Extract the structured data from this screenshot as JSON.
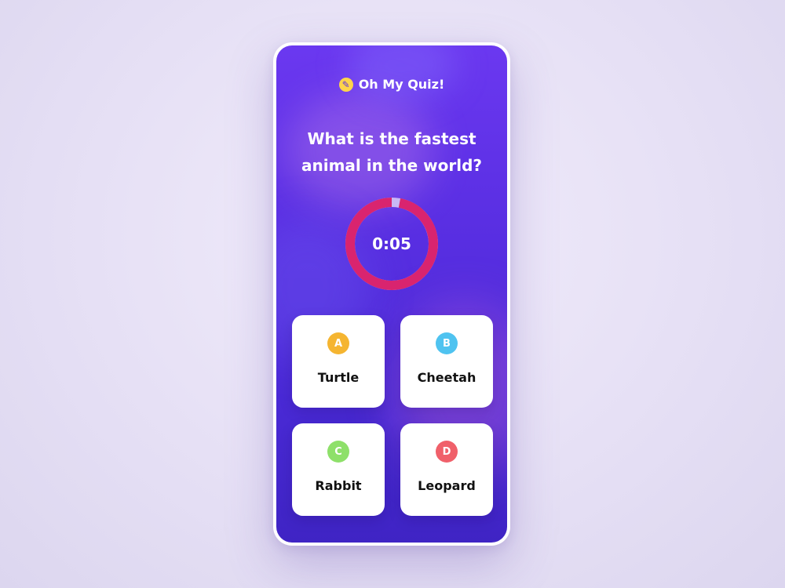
{
  "app": {
    "title": "Oh My Quiz!",
    "icon": "quiz-logo-icon",
    "icon_glyph": "✎"
  },
  "question": {
    "text": "What is the fastest animal in the world?"
  },
  "timer": {
    "display": "0:05",
    "remaining_fraction": 0.97,
    "ring_color": "#d9246f",
    "track_color": "#c9b8f5"
  },
  "answers": [
    {
      "letter": "A",
      "label": "Turtle",
      "badge_color": "#f5b531"
    },
    {
      "letter": "B",
      "label": "Cheetah",
      "badge_color": "#4fc3f0"
    },
    {
      "letter": "C",
      "label": "Rabbit",
      "badge_color": "#8ee06a"
    },
    {
      "letter": "D",
      "label": "Leopard",
      "badge_color": "#f0606a"
    }
  ],
  "colors": {
    "screen_gradient_top": "#6b38f0",
    "screen_gradient_bottom": "#3f24c4",
    "card_background": "#ffffff"
  }
}
